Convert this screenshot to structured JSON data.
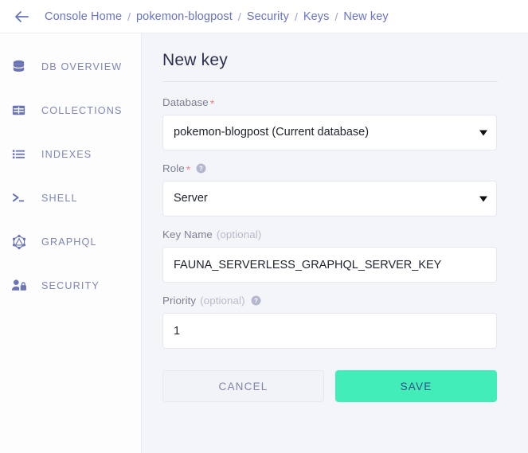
{
  "topbar": {
    "back_icon": "arrow-left-icon",
    "breadcrumb": [
      {
        "label": "Console Home"
      },
      {
        "label": "pokemon-blogpost"
      },
      {
        "label": "Security"
      },
      {
        "label": "Keys"
      },
      {
        "label": "New key"
      }
    ],
    "separator": "/"
  },
  "sidebar": {
    "items": [
      {
        "label": "DB OVERVIEW",
        "icon": "database-icon"
      },
      {
        "label": "COLLECTIONS",
        "icon": "table-grid-icon"
      },
      {
        "label": "INDEXES",
        "icon": "list-icon"
      },
      {
        "label": "SHELL",
        "icon": "terminal-prompt-icon"
      },
      {
        "label": "GRAPHQL",
        "icon": "graphql-icon"
      },
      {
        "label": "SECURITY",
        "icon": "user-lock-icon"
      }
    ]
  },
  "main": {
    "title": "New key",
    "fields": {
      "database": {
        "label": "Database",
        "required_marker": "*",
        "value": "pokemon-blogpost (Current database)",
        "options": [
          "pokemon-blogpost (Current database)"
        ]
      },
      "role": {
        "label": "Role",
        "required_marker": "*",
        "help_icon": "question-circle-icon",
        "value": "Server",
        "options": [
          "Server"
        ]
      },
      "key_name": {
        "label": "Key Name",
        "optional_text": "(optional)",
        "value": "FAUNA_SERVERLESS_GRAPHQL_SERVER_KEY",
        "placeholder": ""
      },
      "priority": {
        "label": "Priority",
        "optional_text": "(optional)",
        "help_icon": "question-circle-icon",
        "value": "1",
        "placeholder": ""
      }
    },
    "buttons": {
      "cancel": "CANCEL",
      "save": "SAVE"
    }
  },
  "colors": {
    "accent_green": "#42edb8",
    "breadcrumb_blue": "#6873c4",
    "sidebar_icon": "#6b75b5",
    "page_bg": "#f4f5f9",
    "required_red": "#ef8585"
  }
}
